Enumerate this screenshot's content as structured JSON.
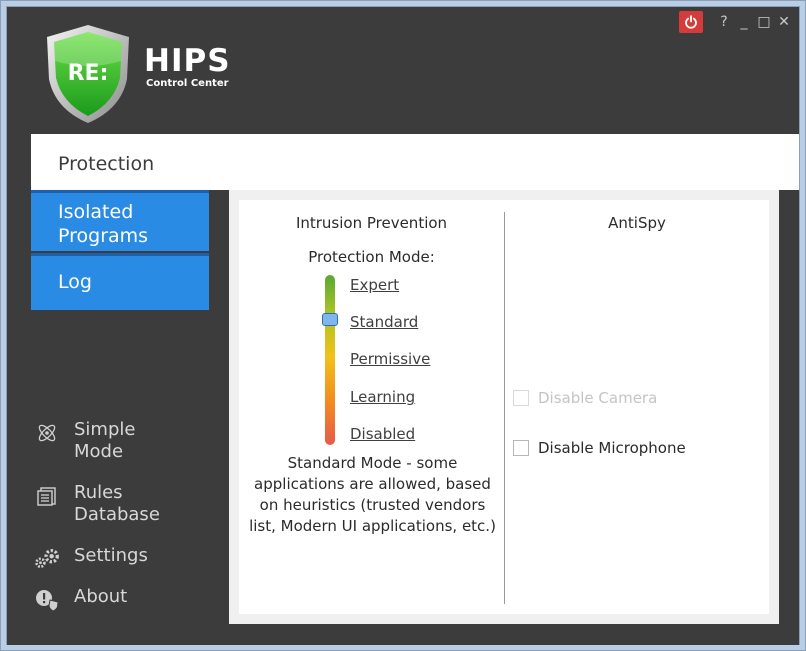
{
  "brand": {
    "logo_text": "RE:",
    "title": "HIPS",
    "subtitle": "Control Center"
  },
  "window_controls": {
    "power_icon": "power-icon",
    "help": "?",
    "minimize": "_",
    "maximize": "□",
    "close": "✕"
  },
  "nav": {
    "active": "Protection",
    "tabs": [
      {
        "label_lines": [
          "Isolated",
          "Programs"
        ]
      },
      {
        "label_lines": [
          "Log"
        ]
      }
    ],
    "side_items": [
      {
        "lines": [
          "Simple",
          "Mode"
        ],
        "icon": "atom-icon"
      },
      {
        "lines": [
          "Rules",
          "Database"
        ],
        "icon": "database-icon"
      },
      {
        "lines": [
          "Settings"
        ],
        "icon": "gears-icon"
      },
      {
        "lines": [
          "About"
        ],
        "icon": "info-icon"
      }
    ]
  },
  "intrusion_prevention": {
    "title": "Intrusion Prevention",
    "mode_label": "Protection Mode:",
    "modes": [
      "Expert",
      "Standard",
      "Permissive",
      "Learning",
      "Disabled"
    ],
    "selected_mode": "Standard",
    "description_lines": [
      "Standard Mode - some",
      "applications are allowed, based",
      "on heuristics (trusted vendors",
      "list, Modern UI applications, etc.)"
    ]
  },
  "antispy": {
    "title": "AntiSpy",
    "options": [
      {
        "label": "Disable Camera",
        "checked": false,
        "enabled": false
      },
      {
        "label": "Disable Microphone",
        "checked": false,
        "enabled": true
      }
    ]
  },
  "colors": {
    "accent": "#2a8be5",
    "power": "#d63b3b",
    "sidebar": "#3c3c3c"
  }
}
